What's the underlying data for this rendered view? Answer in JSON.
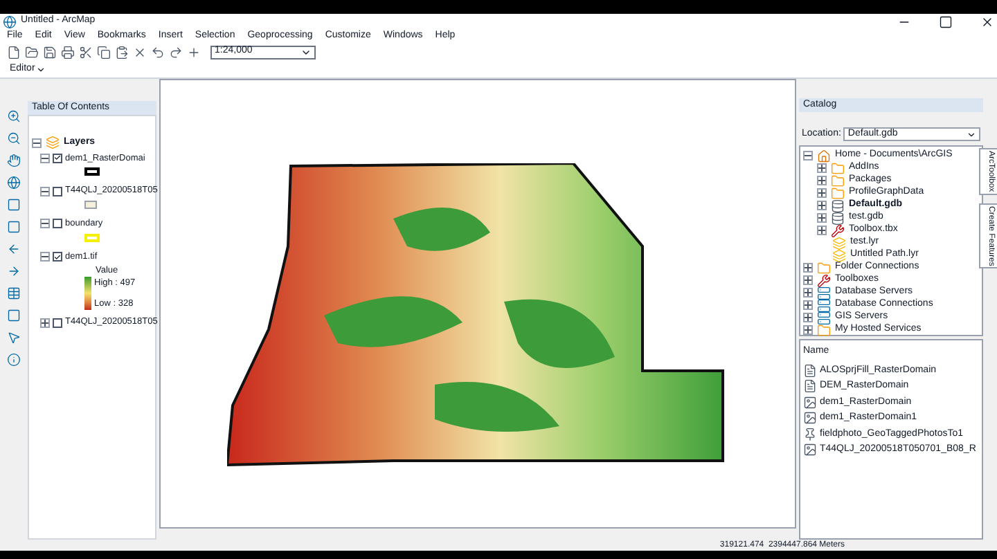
{
  "window": {
    "title": "Untitled - ArcMap"
  },
  "menu": [
    "File",
    "Edit",
    "View",
    "Bookmarks",
    "Insert",
    "Selection",
    "Geoprocessing",
    "Customize",
    "Windows",
    "Help"
  ],
  "toolbar": {
    "scale": "1:24,000",
    "editor": "Editor"
  },
  "toc": {
    "title": "Table Of Contents",
    "root": {
      "name": "Layers",
      "expanded": true
    },
    "layers": [
      {
        "name": "dem1_RasterDomai",
        "checked": true,
        "expanded": true,
        "legend": {
          "kind": "outline",
          "color": "#000000"
        }
      },
      {
        "name": "T44QLJ_20200518T05",
        "checked": false,
        "expanded": true,
        "legend": {
          "kind": "fill",
          "color": "#f3efd8"
        }
      },
      {
        "name": "boundary",
        "checked": false,
        "expanded": true,
        "legend": {
          "kind": "outline",
          "color": "#f5f000"
        }
      },
      {
        "name": "dem1.tif",
        "checked": true,
        "expanded": true,
        "legend": {
          "kind": "ramp",
          "title": "Value",
          "high": "High : 497",
          "low": "Low : 328"
        }
      },
      {
        "name": "T44QLJ_20200518T05",
        "checked": false,
        "expanded": false
      }
    ]
  },
  "catalog": {
    "title": "Catalog",
    "location_label": "Location:",
    "location": "Default.gdb",
    "tree": [
      {
        "name": "Home - Documents\\ArcGIS",
        "kind": "home",
        "expanded": true,
        "children": [
          {
            "name": "AddIns",
            "kind": "folder",
            "expanded": false
          },
          {
            "name": "Packages",
            "kind": "folder",
            "expanded": false
          },
          {
            "name": "ProfileGraphData",
            "kind": "folder",
            "expanded": false
          },
          {
            "name": "Default.gdb",
            "kind": "database",
            "expanded": false,
            "default": true
          },
          {
            "name": "test.gdb",
            "kind": "database",
            "expanded": false,
            "default": false
          },
          {
            "name": "Toolbox.tbx",
            "kind": "toolbox",
            "expanded": false
          },
          {
            "name": "test.lyr",
            "kind": "layer"
          },
          {
            "name": "Untitled Path.lyr",
            "kind": "layer"
          }
        ]
      },
      {
        "name": "Folder Connections",
        "kind": "folder",
        "expanded": false
      },
      {
        "name": "Toolboxes",
        "kind": "toolbox",
        "expanded": false
      },
      {
        "name": "Database Servers",
        "kind": "server",
        "expanded": false
      },
      {
        "name": "Database Connections",
        "kind": "server",
        "expanded": false
      },
      {
        "name": "GIS Servers",
        "kind": "server",
        "expanded": false
      },
      {
        "name": "My Hosted Services",
        "kind": "folder",
        "expanded": false
      }
    ],
    "contents_header": "Name",
    "contents": [
      {
        "name": "ALOSprjFill_RasterDomain",
        "kind": "line"
      },
      {
        "name": "DEM_RasterDomain",
        "kind": "line"
      },
      {
        "name": "dem1_RasterDomain",
        "kind": "raster"
      },
      {
        "name": "dem1_RasterDomain1",
        "kind": "raster"
      },
      {
        "name": "fieldphoto_GeoTaggedPhotosTo1",
        "kind": "point"
      },
      {
        "name": "T44QLJ_20200518T050701_B08_R",
        "kind": "raster"
      }
    ]
  },
  "side_tabs": [
    "ArcToolbox",
    "Create Features"
  ],
  "status": {
    "coordinates": "319121.474  2394447.864 Meters"
  }
}
